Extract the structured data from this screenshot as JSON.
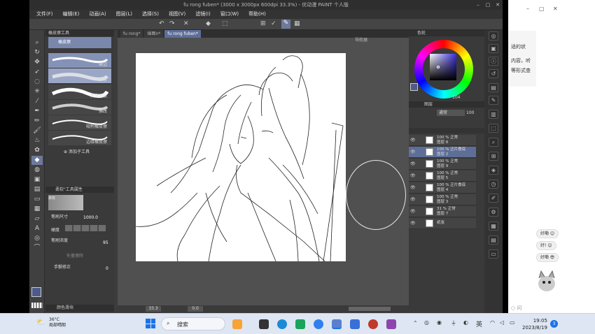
{
  "window": {
    "title": "fu rong fuben* (3000 x 3000px 600dpi 33.3%) - 优动漫 PAINT 个人版"
  },
  "menu": [
    "文件(F)",
    "编辑(E)",
    "动画(A)",
    "图层(L)",
    "选择(S)",
    "视图(V)",
    "滤镜(I)",
    "窗口(W)",
    "帮助(H)"
  ],
  "subtool": {
    "header": "橡皮擦工具",
    "selected_label": "橡皮擦",
    "brushes": [
      "硬边",
      "柔软",
      "贯穿图层",
      "描改",
      "吸附橡皮擦",
      "边缘橡皮擦"
    ],
    "add_label": "添加子工具"
  },
  "toolprops": {
    "header": "柔软\"工具属性",
    "preset": "柔软",
    "brush_size_label": "笔刷尺寸",
    "brush_size": "1000.0",
    "hardness_label": "硬度",
    "density_label": "笔刷浓度",
    "density": "95",
    "vector_label": "矢量擦除",
    "stabilize_label": "手颤修正",
    "stabilize": "0"
  },
  "bottom_tab": "颜色滑块",
  "tabs": [
    "fu rong*",
    "插图n*",
    "fu rong fuben*"
  ],
  "navigator": {
    "label": "导航器"
  },
  "status": {
    "zoom": "33.3",
    "angle": "0.0"
  },
  "color": {
    "header": "色轮",
    "value": "104"
  },
  "layers_panel": {
    "header": "图层",
    "blend": "通常",
    "opacity": "100"
  },
  "layers": [
    {
      "line1": "100 % 正常",
      "line2": "图层 8"
    },
    {
      "line1": "100 % 正片叠底",
      "line2": "图层 2"
    },
    {
      "line1": "100 % 正常",
      "line2": "图层 9"
    },
    {
      "line1": "100 % 正常",
      "line2": "图层 5"
    },
    {
      "line1": "100 % 正片叠底",
      "line2": "图层 4"
    },
    {
      "line1": "100 % 正常",
      "line2": "图层 3"
    },
    {
      "line1": "31 % 正常",
      "line2": "图层 7"
    },
    {
      "line1": "",
      "line2": "纸张"
    }
  ],
  "chat": {
    "text1": "适的状",
    "text2": "内容，听",
    "text3": "等形式查",
    "bubbles": [
      "好嘞",
      "好!",
      "好嘞"
    ],
    "bottom": "问"
  },
  "taskbar": {
    "temp": "36°C",
    "weather": "局部晴朗",
    "search": "搜索",
    "lang": "英",
    "time": "19:05",
    "date": "2023/8/19",
    "badge": "3"
  }
}
